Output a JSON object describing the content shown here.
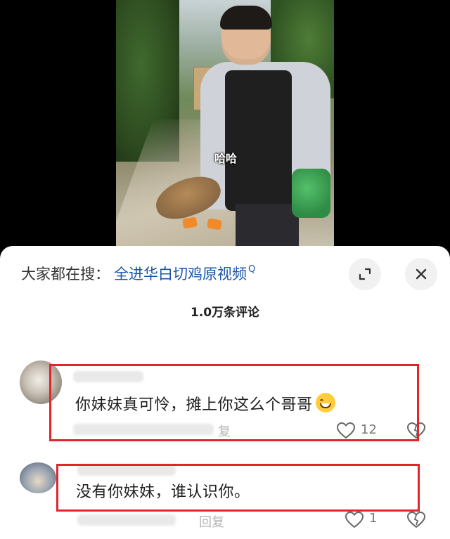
{
  "video": {
    "caption": "哈哈"
  },
  "search": {
    "prefix": "大家都在搜：",
    "term": "全进华白切鸡原视频",
    "mark": "Q"
  },
  "comments_header": {
    "count": "1.0万条评论"
  },
  "comments": [
    {
      "text": "你妹妹真可怜，摊上你这么个哥哥",
      "emoji": "grinning-face",
      "reply_label": "复",
      "likes": "12",
      "highlight_color": "#e0262a"
    },
    {
      "text": "没有你妹妹，谁认识你。",
      "reply_label": "回复",
      "likes": "1",
      "highlight_color": "#e0262a"
    }
  ],
  "icons": {
    "expand": "expand-icon",
    "close": "close-icon",
    "like": "heart-outline-icon",
    "dislike": "dislike-heart-icon"
  }
}
